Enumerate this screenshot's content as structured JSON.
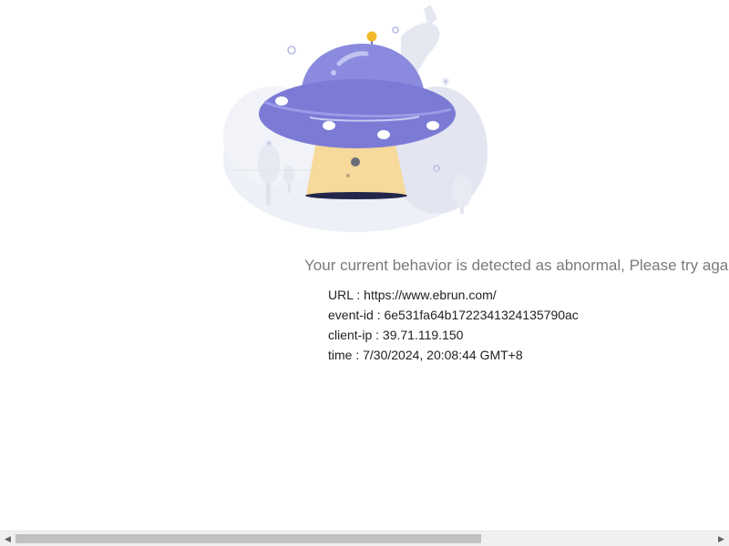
{
  "message": "Your current behavior is detected as abnormal, Please try again later.",
  "details": [
    "URL : https://www.ebrun.com/",
    "event-id : 6e531fa64b1722341324135790ac",
    "client-ip : 39.71.119.150",
    "time : 7/30/2024, 20:08:44 GMT+8"
  ],
  "illustration": {
    "icon": "ufo-icon",
    "colors": {
      "ufo_body": "#7b7bd6",
      "ufo_dome": "#8a8ade",
      "ufo_beam": "#f6d99b",
      "antenna": "#f0b929",
      "background": "#edf0f6"
    }
  },
  "scrollbar": {
    "left_arrow": "◀",
    "right_arrow": "▶"
  }
}
